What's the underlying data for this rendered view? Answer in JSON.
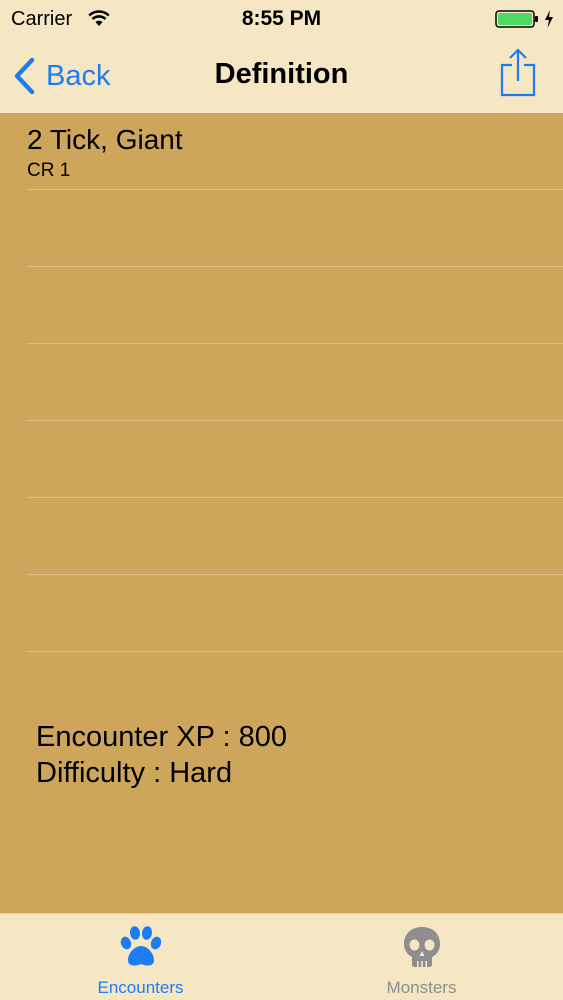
{
  "status_bar": {
    "carrier": "Carrier",
    "time": "8:55 PM"
  },
  "nav": {
    "back_label": "Back",
    "title": "Definition"
  },
  "encounter": {
    "rows": [
      {
        "title": "2 Tick, Giant",
        "subtitle": "CR 1"
      },
      {
        "title": "",
        "subtitle": ""
      },
      {
        "title": "",
        "subtitle": ""
      },
      {
        "title": "",
        "subtitle": ""
      },
      {
        "title": "",
        "subtitle": ""
      },
      {
        "title": "",
        "subtitle": ""
      },
      {
        "title": "",
        "subtitle": ""
      }
    ],
    "xp_line": "Encounter XP : 800",
    "difficulty_line": "Difficulty : Hard"
  },
  "tab_bar": {
    "tabs": [
      {
        "label": "Encounters",
        "icon": "paw-icon",
        "active": true
      },
      {
        "label": "Monsters",
        "icon": "skull-icon",
        "active": false
      }
    ]
  },
  "colors": {
    "background": "#cda65c",
    "chrome": "#f5e7c4",
    "accent": "#1e7cf2",
    "battery": "#4cd964",
    "inactive_tab": "#8e8e8e"
  }
}
